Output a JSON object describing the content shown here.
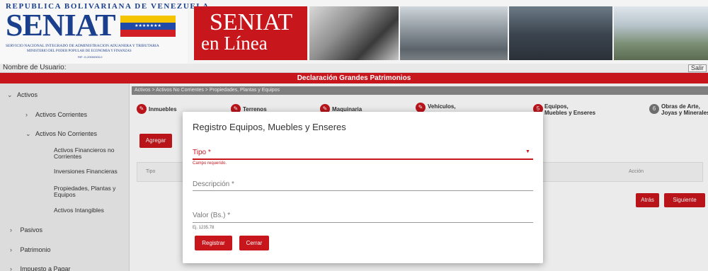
{
  "banner": {
    "republic": "REPUBLICA BOLIVARIANA DE VENEZUELA",
    "logo": "SENIAT",
    "subtitle1": "SERVICIO NACIONAL INTEGRADO DE ADMINISTRACION ADUANERA Y TRIBUTARIA",
    "subtitle2": "MINISTERIO DEL PODER POPULAR DE ECONOMIA Y FINANZAS",
    "rif": "RIF: G-20000303-0",
    "enlinea_1": "SENIAT",
    "enlinea_2": "en Línea"
  },
  "userbar": {
    "username_label": "Nombre de Usuario:",
    "salir": "Salir"
  },
  "title": "Declaración Grandes Patrimonios",
  "sidebar": {
    "activos": "Activos",
    "activos_corrientes": "Activos Corrientes",
    "activos_no_corrientes": "Activos No Corrientes",
    "sub_items": [
      "Activos Financieros no Corrientes",
      "Inversiones Financieras",
      "Propiedades, Plantas y Equipos",
      "Activos Intangibles"
    ],
    "pasivos": "Pasivos",
    "patrimonio": "Patrimonio",
    "impuesto": "Impuesto a Pagar"
  },
  "breadcrumb": "Activos > Activos No Corrientes > Propiedades, Plantas y Equipos",
  "steps": [
    {
      "label": "Inmuebles",
      "icon": "pencil-icon"
    },
    {
      "label": "Terrenos",
      "icon": "pencil-icon"
    },
    {
      "label": "Maquinaria",
      "icon": "pencil-icon"
    },
    {
      "label": "Vehículos,",
      "icon": "pencil-icon"
    },
    {
      "label1": "Equipos,",
      "label2": "Muebles y Enseres",
      "number": "5"
    },
    {
      "label1": "Obras de Arte,",
      "label2": "Joyas y Minerales",
      "number": "6"
    }
  ],
  "main": {
    "agregar": "Agregar",
    "col_tipo": "Tipo",
    "col_accion": "Acción",
    "atras": "Atrás",
    "siguiente": "Siguiente"
  },
  "modal": {
    "title": "Registro Equipos, Muebles y Enseres",
    "tipo_label": "Tipo *",
    "tipo_error": "Campo requerido.",
    "descripcion_label": "Descripción *",
    "valor_label": "Valor (Bs.) *",
    "valor_hint": "Ej. 1235.78",
    "registrar": "Registrar",
    "cerrar": "Cerrar"
  },
  "colors": {
    "accent": "#c8161d",
    "brand_blue": "#1a3f8c"
  }
}
